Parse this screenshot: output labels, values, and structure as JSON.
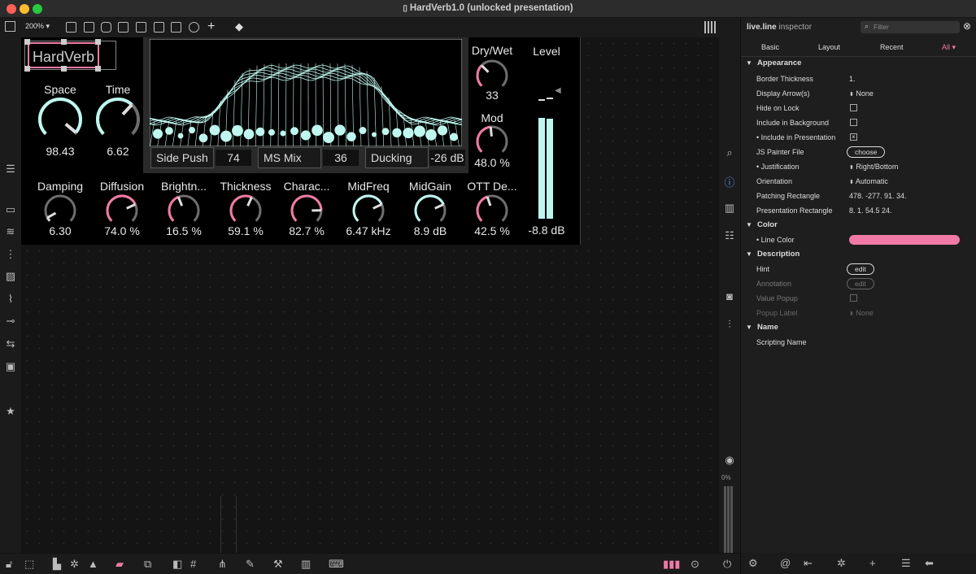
{
  "window": {
    "title": "HardVerb1.0 (unlocked presentation)"
  },
  "colors": {
    "accent_pink": "#f07aa5",
    "accent_cyan": "#bff7ee",
    "knob_arc": "#6e6e6e"
  },
  "toolbar": {
    "zoom": "200%"
  },
  "device": {
    "title": "HardVerb",
    "knobs_top": [
      {
        "label": "Space",
        "value": "98.43",
        "norm": 0.98,
        "color": "cyan"
      },
      {
        "label": "Time",
        "value": "6.62",
        "norm": 0.66,
        "color": "cyan"
      }
    ],
    "knobs_bottom": [
      {
        "label": "Damping",
        "value": "6.30",
        "norm": 0.06,
        "color": "gray"
      },
      {
        "label": "Diffusion",
        "value": "74.0 %",
        "norm": 0.74,
        "color": "pink"
      },
      {
        "label": "Brightn...",
        "value": "16.5 %",
        "norm": 0.42,
        "color": "pink"
      },
      {
        "label": "Thickness",
        "value": "59.1 %",
        "norm": 0.59,
        "color": "pink"
      },
      {
        "label": "Charac...",
        "value": "82.7 %",
        "norm": 0.83,
        "color": "pink"
      },
      {
        "label": "MidFreq",
        "value": "6.47 kHz",
        "norm": 0.74,
        "color": "cyan"
      },
      {
        "label": "MidGain",
        "value": "8.9 dB",
        "norm": 0.74,
        "color": "cyan"
      },
      {
        "label": "OTT De...",
        "value": "42.5 %",
        "norm": 0.43,
        "color": "pink"
      }
    ],
    "knobs_right": [
      {
        "label": "Dry/Wet",
        "value": "33",
        "norm": 0.33,
        "color": "pink"
      },
      {
        "label": "Mod",
        "value": "48.0 %",
        "norm": 0.48,
        "color": "pink"
      }
    ],
    "fields": {
      "side_push_label": "Side Push",
      "side_push_value": "74",
      "ms_mix_label": "MS Mix",
      "ms_mix_value": "36",
      "ducking_label": "Ducking",
      "ducking_value": "-26 dB"
    },
    "level": {
      "label": "Level",
      "value": "-8.8 dB",
      "left": 0.83,
      "right": 0.82
    }
  },
  "inspector": {
    "title_bold": "live.line",
    "title_rest": "inspector",
    "filter_placeholder": "Filter",
    "tabs": [
      "Basic",
      "Layout",
      "Recent",
      "All"
    ],
    "sections": {
      "appearance": "Appearance",
      "color": "Color",
      "description": "Description",
      "name": "Name"
    },
    "rows": {
      "border_thickness": {
        "label": "Border Thickness",
        "value": "1."
      },
      "display_arrows": {
        "label": "Display Arrow(s)",
        "value": "None"
      },
      "hide_on_lock": {
        "label": "Hide on Lock"
      },
      "include_background": {
        "label": "Include in Background"
      },
      "include_presentation": {
        "label": "Include in Presentation"
      },
      "js_painter": {
        "label": "JS Painter File",
        "value": "choose"
      },
      "justification": {
        "label": "Justification",
        "value": "Right/Bottom"
      },
      "orientation": {
        "label": "Orientation",
        "value": "Automatic"
      },
      "patching_rect": {
        "label": "Patching Rectangle",
        "value": "478. -277. 91. 34."
      },
      "presentation_rect": {
        "label": "Presentation Rectangle",
        "value": "8. 1. 54.5 24."
      },
      "line_color": {
        "label": "Line Color",
        "value": "#f07aa5"
      },
      "hint": {
        "label": "Hint",
        "value": "edit"
      },
      "annotation": {
        "label": "Annotation",
        "value": "edit"
      },
      "value_popup": {
        "label": "Value Popup"
      },
      "popup_label": {
        "label": "Popup Label",
        "value": "None"
      },
      "scripting_name": {
        "label": "Scripting Name"
      }
    }
  },
  "rightbar": {
    "cpu": "0%"
  }
}
